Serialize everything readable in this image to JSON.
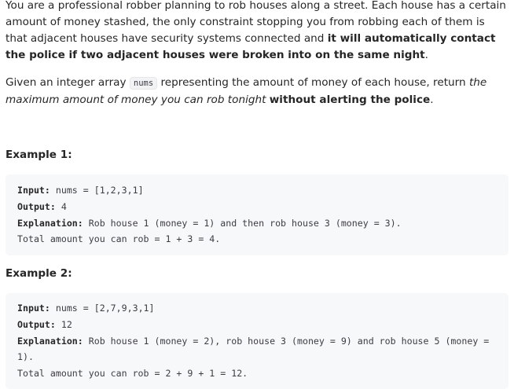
{
  "description": {
    "p1_a": "You are a professional robber planning to rob houses along a street. Each house has a certain amount of money stashed, the only constraint stopping you from robbing each of them is that adjacent houses have security systems connected and ",
    "p1_b": "it will automatically contact the police if two adjacent houses were broken into on the same night",
    "p1_c": ".",
    "p2_a": "Given an integer array ",
    "p2_code": "nums",
    "p2_b": " representing the amount of money of each house, return ",
    "p2_i": "the maximum amount of money you can rob tonight ",
    "p2_bold": "without alerting the police",
    "p2_c": "."
  },
  "examples": [
    {
      "title": "Example 1:",
      "input_label": "Input:",
      "input_value": " nums = [1,2,3,1]",
      "output_label": "Output:",
      "output_value": " 4",
      "explanation_label": "Explanation:",
      "explanation_value": " Rob house 1 (money = 1) and then rob house 3 (money = 3).",
      "explanation_cont": "Total amount you can rob = 1 + 3 = 4."
    },
    {
      "title": "Example 2:",
      "input_label": "Input:",
      "input_value": " nums = [2,7,9,3,1]",
      "output_label": "Output:",
      "output_value": " 12",
      "explanation_label": "Explanation:",
      "explanation_value": " Rob house 1 (money = 2), rob house 3 (money = 9) and rob house 5 (money = 1).",
      "explanation_cont": "Total amount you can rob = 2 + 9 + 1 = 12."
    }
  ]
}
